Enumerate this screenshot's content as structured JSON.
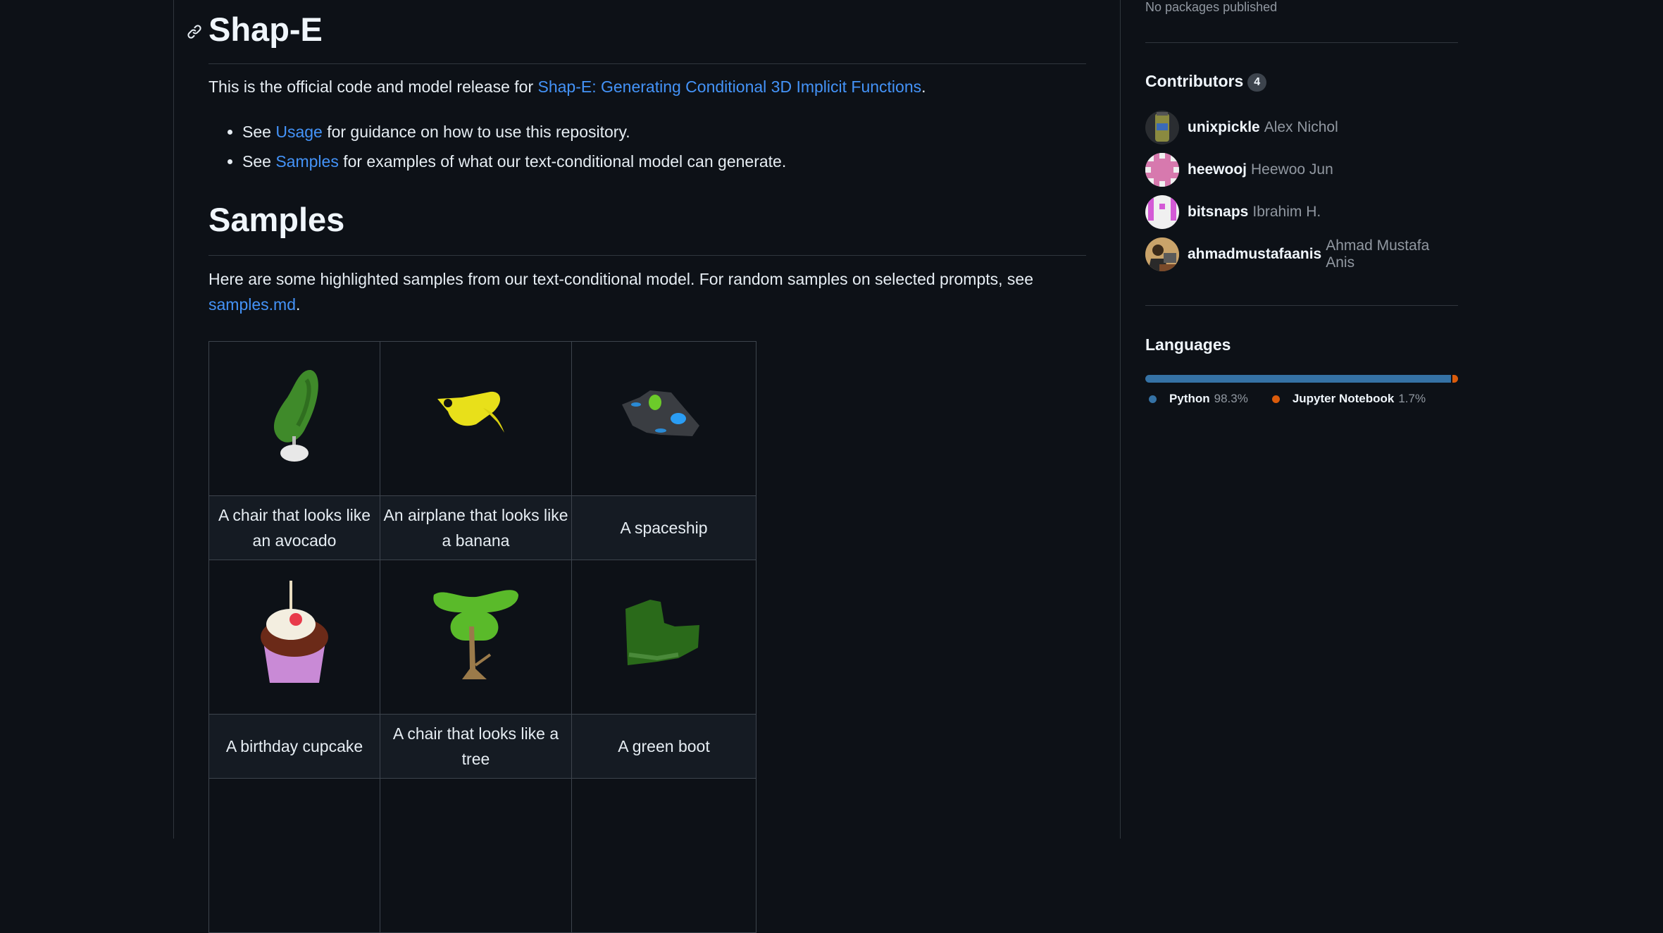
{
  "readme": {
    "title": "Shap-E",
    "intro_prefix": "This is the official code and model release for ",
    "intro_link": "Shap-E: Generating Conditional 3D Implicit Functions",
    "intro_suffix": ".",
    "bullets": [
      {
        "prefix": "See ",
        "link": "Usage",
        "suffix": " for guidance on how to use this repository."
      },
      {
        "prefix": "See ",
        "link": "Samples",
        "suffix": " for examples of what our text-conditional model can generate."
      }
    ],
    "samples_heading": "Samples",
    "samples_text": "Here are some highlighted samples from our text-conditional model. For random samples on selected prompts, see ",
    "samples_link": "samples.md",
    "samples_suffix": ".",
    "table": [
      [
        {
          "caption": "A chair that looks like an avocado",
          "image": "avocado-chair"
        },
        {
          "caption": "An airplane that looks like a banana",
          "image": "banana-airplane"
        },
        {
          "caption": "A spaceship",
          "image": "spaceship"
        }
      ],
      [
        {
          "caption": "A birthday cupcake",
          "image": "birthday-cupcake"
        },
        {
          "caption": "A chair that looks like a tree",
          "image": "tree-chair"
        },
        {
          "caption": "A green boot",
          "image": "green-boot"
        }
      ]
    ]
  },
  "sidebar": {
    "packages_text": "No packages published",
    "contributors_title": "Contributors",
    "contributors_count": "4",
    "contributors": [
      {
        "login": "unixpickle",
        "name": "Alex Nichol"
      },
      {
        "login": "heewooj",
        "name": "Heewoo Jun"
      },
      {
        "login": "bitsnaps",
        "name": "Ibrahim H."
      },
      {
        "login": "ahmadmustafaanis",
        "name": "Ahmad Mustafa Anis"
      }
    ],
    "languages_title": "Languages",
    "languages": [
      {
        "name": "Python",
        "percent": "98.3%",
        "value": 98.3,
        "color": "#3572A5"
      },
      {
        "name": "Jupyter Notebook",
        "percent": "1.7%",
        "value": 1.7,
        "color": "#DA5B0B"
      }
    ]
  }
}
